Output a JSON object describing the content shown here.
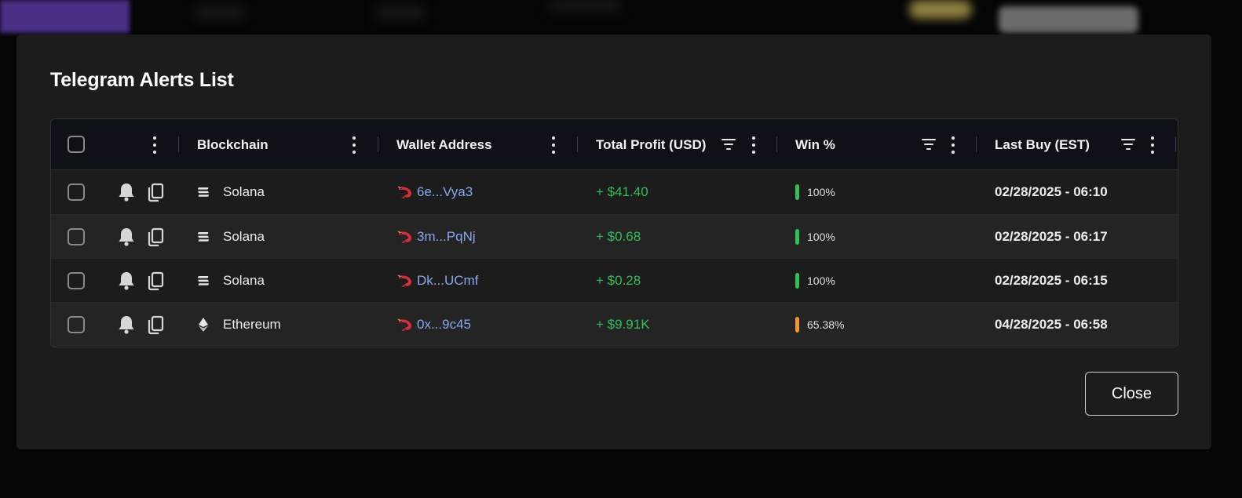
{
  "modal": {
    "title": "Telegram Alerts List",
    "close_label": "Close"
  },
  "table": {
    "columns": [
      {
        "label": "Blockchain"
      },
      {
        "label": "Wallet Address"
      },
      {
        "label": "Total Profit (USD)"
      },
      {
        "label": "Win %"
      },
      {
        "label": "Last Buy (EST)"
      }
    ],
    "rows": [
      {
        "chain": "Solana",
        "chain_icon": "solana-icon",
        "wallet": "6e...Vya3",
        "profit": "+ $41.40",
        "win": "100%",
        "win_color": "#2fc056",
        "last_buy": "02/28/2025 - 06:10"
      },
      {
        "chain": "Solana",
        "chain_icon": "solana-icon",
        "wallet": "3m...PqNj",
        "profit": "+ $0.68",
        "win": "100%",
        "win_color": "#2fc056",
        "last_buy": "02/28/2025 - 06:17"
      },
      {
        "chain": "Solana",
        "chain_icon": "solana-icon",
        "wallet": "Dk...UCmf",
        "profit": "+ $0.28",
        "win": "100%",
        "win_color": "#2fc056",
        "last_buy": "02/28/2025 - 06:15"
      },
      {
        "chain": "Ethereum",
        "chain_icon": "ethereum-icon",
        "wallet": "0x...9c45",
        "profit": "+ $9.91K",
        "win": "65.38%",
        "win_color": "#f0962e",
        "last_buy": "04/28/2025 - 06:58"
      }
    ]
  },
  "colors": {
    "profit": "#2fc056",
    "wallet_link": "#86a8f2",
    "header_bg": "#0f1119",
    "modal_bg": "#1c1c1c"
  }
}
